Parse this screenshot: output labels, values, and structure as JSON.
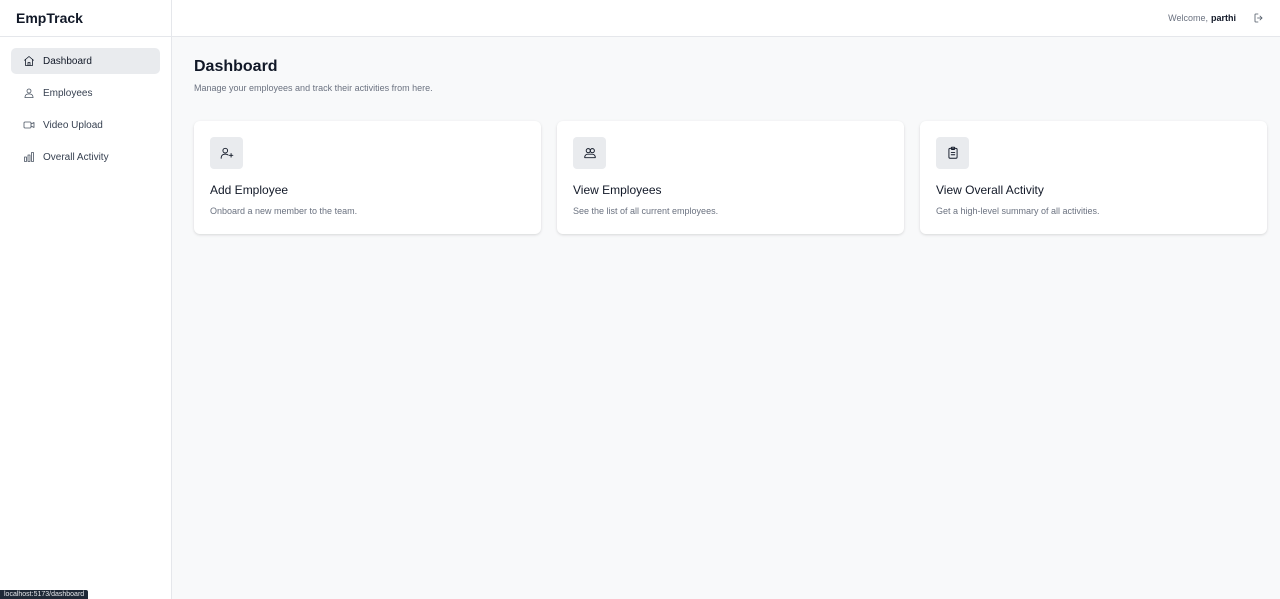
{
  "app": {
    "brand": "EmpTrack"
  },
  "sidebar": {
    "items": [
      {
        "label": "Dashboard",
        "icon": "home-icon",
        "active": true
      },
      {
        "label": "Employees",
        "icon": "users-icon",
        "active": false
      },
      {
        "label": "Video Upload",
        "icon": "video-icon",
        "active": false
      },
      {
        "label": "Overall Activity",
        "icon": "bar-chart-icon",
        "active": false
      }
    ]
  },
  "topbar": {
    "welcome": "Welcome,",
    "username": "parthi",
    "logout_icon": "logout-icon"
  },
  "main": {
    "title": "Dashboard",
    "subtitle": "Manage your employees and track their activities from here.",
    "cards": [
      {
        "title": "Add Employee",
        "description": "Onboard a new member to the team.",
        "icon": "user-plus-icon"
      },
      {
        "title": "View Employees",
        "description": "See the list of all current employees.",
        "icon": "users-icon"
      },
      {
        "title": "View Overall Activity",
        "description": "Get a high-level summary of all activities.",
        "icon": "clipboard-icon"
      }
    ]
  },
  "statusbar": {
    "url": "localhost:5173/dashboard"
  },
  "colors": {
    "sidebar_active_bg": "#e9ebee",
    "page_bg": "#f8f9fa",
    "card_bg": "#ffffff"
  }
}
